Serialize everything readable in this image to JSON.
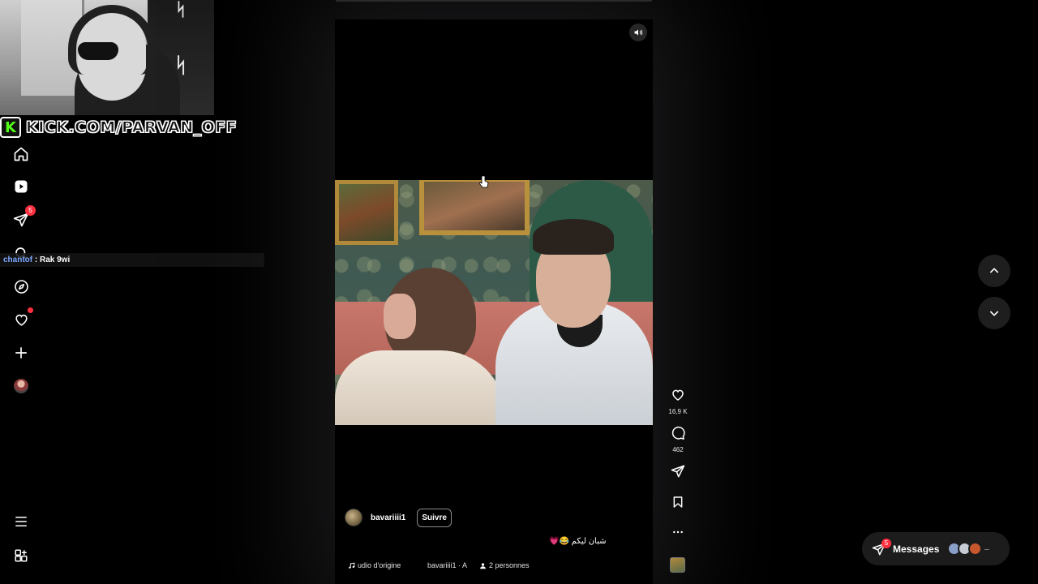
{
  "stream_overlay": {
    "kick_logo_letter": "K",
    "kick_url": "KICK.COM/PARVAN_OFF",
    "chat": {
      "user": "chantof",
      "separator": " : ",
      "message": "Rak 9wi"
    }
  },
  "sidebar": {
    "items": [
      {
        "name": "home-icon"
      },
      {
        "name": "reels-icon"
      },
      {
        "name": "messages-icon",
        "badge": "5"
      },
      {
        "name": "search-icon"
      },
      {
        "name": "explore-icon"
      },
      {
        "name": "notifications-icon",
        "has_dot": true
      },
      {
        "name": "create-icon"
      },
      {
        "name": "profile-avatar"
      }
    ],
    "bottom": [
      {
        "name": "menu-icon"
      },
      {
        "name": "apps-icon"
      }
    ]
  },
  "reel": {
    "author": "bavariiii1",
    "follow_label": "Suivre",
    "caption": "شبان ليكم 😂💗",
    "audio_label": "udio d'origine",
    "audio_author": "bavariiii1 · A",
    "people_label": "2 personnes"
  },
  "actions": {
    "likes": "16,9 K",
    "comments": "462"
  },
  "messages": {
    "label": "Messages",
    "badge": "5",
    "more": "···"
  },
  "colors": {
    "accent_red": "#ff3040",
    "kick_green": "#53fc18",
    "background": "#000000"
  }
}
